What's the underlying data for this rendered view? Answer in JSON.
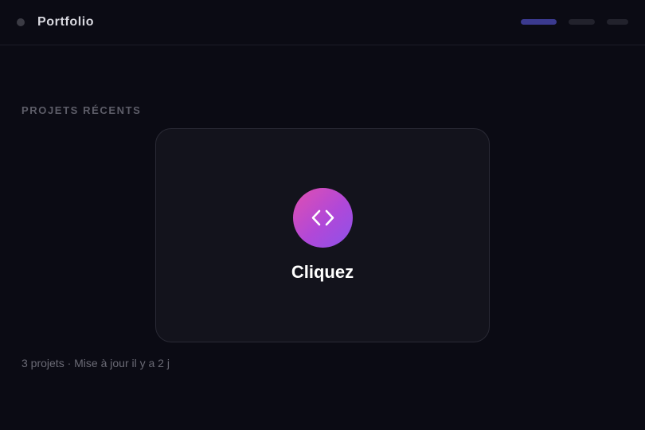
{
  "header": {
    "title": "Portfolio",
    "nav": [
      {
        "name": "nav-pill-1",
        "color": "#3b3a8f"
      },
      {
        "name": "nav-pill-2",
        "color": "#22222c"
      },
      {
        "name": "nav-pill-3",
        "color": "#22222c"
      }
    ]
  },
  "section": {
    "label": "PROJETS RÉCENTS"
  },
  "card": {
    "label": "Cliquez",
    "icon": "code-icon"
  },
  "footer": {
    "summary": "3 projets · Mise à jour il y a 2 j"
  }
}
